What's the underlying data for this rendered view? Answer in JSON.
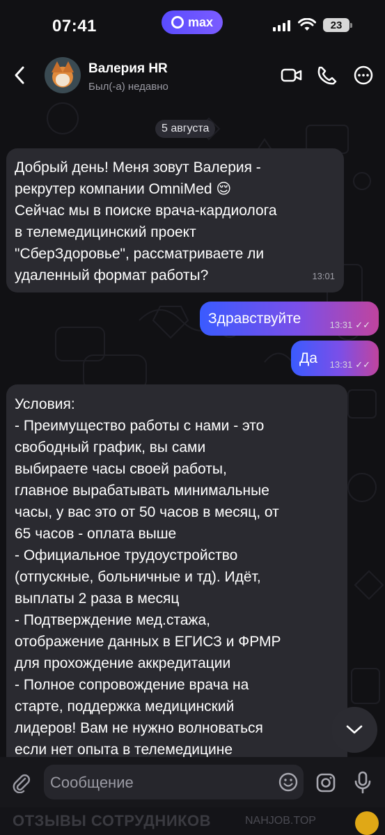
{
  "status_bar": {
    "time": "07:41",
    "app_badge": "max",
    "battery": "23"
  },
  "header": {
    "contact_name": "Валерия HR",
    "contact_status": "Был(-а) недавно"
  },
  "chat": {
    "date_separator": "5 августа",
    "messages": [
      {
        "direction": "in",
        "text": "Добрый день! Меня зовут Валерия -\nрекрутер компании OmniMed 😌\nСейчас мы в поиске врача-кардиолога\nв телемедицинский проект\n\"СберЗдоровье\", рассматриваете ли\nудаленный формат работы?",
        "time": "13:01"
      },
      {
        "direction": "out",
        "text": "Здравствуйте",
        "time": "13:31"
      },
      {
        "direction": "out",
        "text": "Да",
        "time": "13:31"
      },
      {
        "direction": "in",
        "text": "Условия:\n- Преимущество работы с нами - это\nсвободный график, вы сами\nвыбираете часы своей работы,\nглавное вырабатывать минимальные\nчасы, у вас это от 50 часов в месяц, от\n65 часов - оплата выше\n- Официальное трудоустройство\n(отпускные, больничные и тд). Идёт,\nвыплаты 2 раза в месяц\n- Подтверждение мед.стажа,\nотображение данных в ЕГИСЗ и ФРМР\nдля прохождение аккредитации\n- Полное сопровождение врача на\nстарте, поддержка медицинский\nлидеров! Вам не нужно волноваться\nесли нет опыта в телемедицине"
      }
    ]
  },
  "composer": {
    "placeholder": "Сообщение",
    "value": ""
  },
  "watermark": {
    "left": "ОТЗЫВЫ СОТРУДНИКОВ",
    "right": "NAHJOB.TOP"
  },
  "colors": {
    "accent": "#5a4cff",
    "outgoing_gradient": [
      "#3a5bff",
      "#7b4fe8",
      "#c0449e"
    ],
    "incoming_bubble": "#2a2a30",
    "background": "#111114"
  }
}
